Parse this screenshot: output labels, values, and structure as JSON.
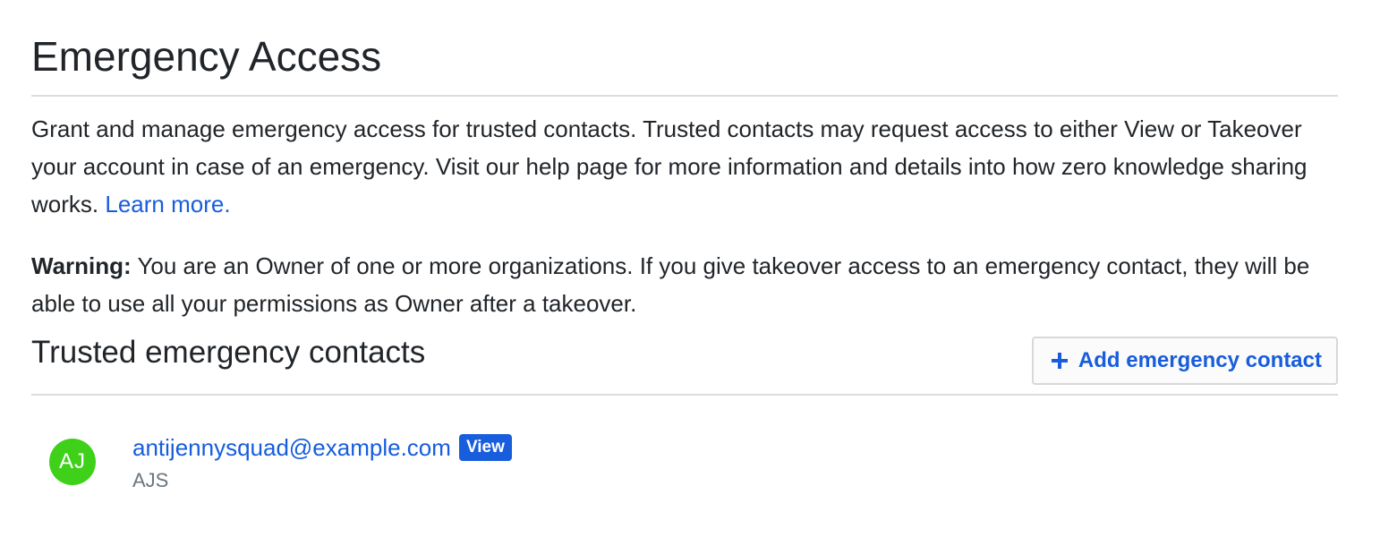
{
  "page": {
    "title": "Emergency Access",
    "description": "Grant and manage emergency access for trusted contacts. Trusted contacts may request access to either View or Takeover your account in case of an emergency. Visit our help page for more information and details into how zero knowledge sharing works.",
    "learn_more_label": "Learn more.",
    "warning_label": "Warning:",
    "warning_text": "You are an Owner of one or more organizations. If you give takeover access to an emergency contact, they will be able to use all your permissions as Owner after a takeover."
  },
  "contacts_section": {
    "title": "Trusted emergency contacts",
    "add_button_label": "Add emergency contact",
    "add_button_icon": "plus-icon",
    "items": [
      {
        "avatar_initials": "AJ",
        "avatar_color": "#3fd11a",
        "email": "antijennysquad@example.com",
        "access_badge": "View",
        "name": "AJS"
      }
    ]
  },
  "colors": {
    "link": "#175ddc",
    "badge_bg": "#175ddc",
    "muted_text": "#6c757d"
  }
}
